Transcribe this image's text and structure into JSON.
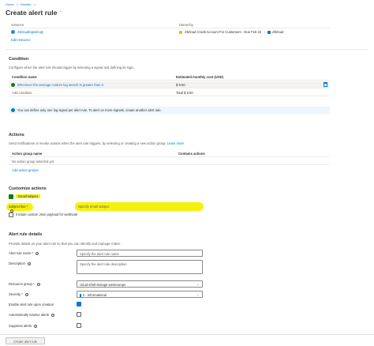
{
  "breadcrumb": {
    "items": [
      "Home",
      "Monitor"
    ],
    "sep": ">"
  },
  "page": {
    "title": "Create alert rule",
    "more": "···"
  },
  "scope": {
    "col_resource": "resource",
    "col_hierarchy": "Hierarchy",
    "resource_name": "Zbrloudlogsinlogs",
    "hierarchy_text": "Zbrloud Credit Account For Customers - Due Feb 22",
    "hierarchy_tail": "Zbrloud",
    "edit_link": "Edit resource"
  },
  "condition": {
    "heading": "Condition",
    "desc": "Configure when the alert rule should trigger by selecting a signal and defining its logic.",
    "col_name": "Condition name",
    "col_cost": "Estimated monthly cost (USD)",
    "row_name": "Whenever the average custom log search is greater than 0",
    "row_cost": "$ 9.50",
    "add_link": "Add condition",
    "total": "Total $ 9.50",
    "note": "You can define only one log signal per alert rule. To alert on more signals, create another alert rule."
  },
  "actions": {
    "heading": "Actions",
    "desc": "Send notifications or invoke actions when the alert rule triggers, by selecting or creating a new action group.",
    "learn": "Learn more",
    "col_group": "Action group name",
    "col_contains": "Contains actions",
    "empty": "No action group selected yet",
    "add_link": "Add action groups"
  },
  "customize": {
    "heading": "Customize actions",
    "email_label": "Email subject",
    "subject_label": "Subject line *",
    "subject_placeholder": "Specify email subject",
    "payload_label": "Include custom Json payload for webhook"
  },
  "details": {
    "heading": "Alert rule details",
    "desc": "Provide details on your alert rule so that you can identify and manage it later.",
    "name_label": "Alert rule name *",
    "name_placeholder": "Specify the alert rule name",
    "desc_label": "Description",
    "desc_placeholder": "Specify the alert rule description",
    "rg_label": "Resource group *",
    "rg_value": "cloud-shell-storage-westeurope",
    "sev_label": "Severity *",
    "sev_value": "3 - Informational",
    "enable_label": "Enable alert rule upon creation",
    "autoresolve_label": "Automatically resolve alerts",
    "suppress_label": "Suppress alerts"
  },
  "footer": {
    "create_button": "Create alert rule"
  },
  "colors": {
    "accent": "#0078d4",
    "highlight": "#f4f20c",
    "success": "#107c10"
  }
}
